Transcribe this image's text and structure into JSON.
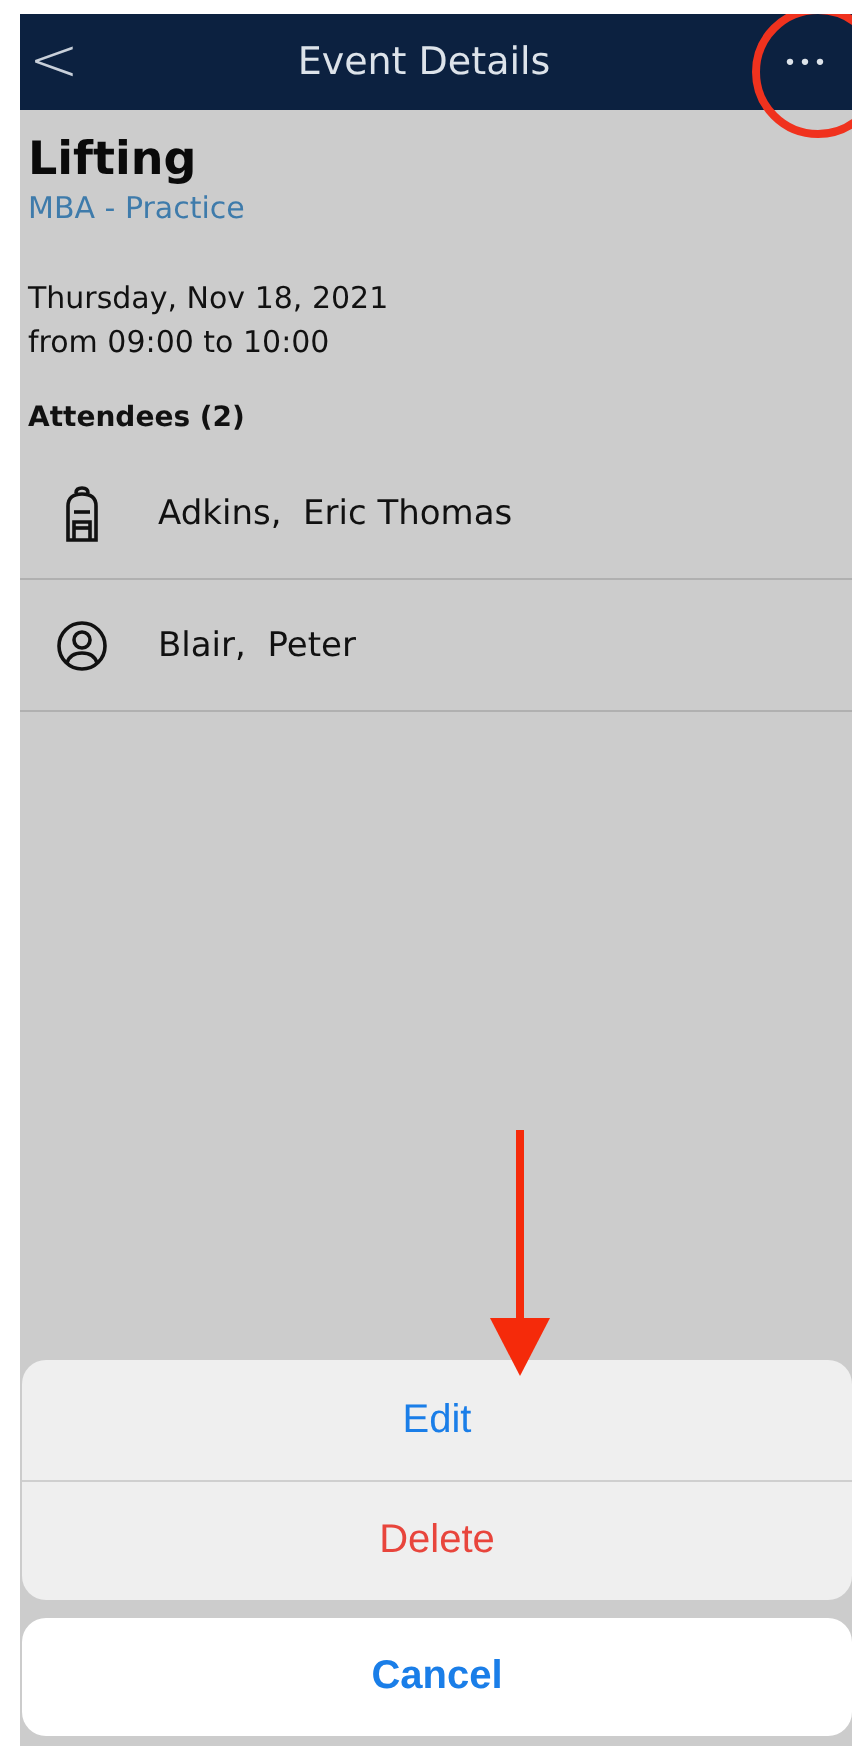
{
  "header": {
    "back": "<",
    "title": "Event Details",
    "more": "•••"
  },
  "event": {
    "title": "Lifting",
    "group": "MBA - Practice",
    "date": "Thursday, Nov 18, 2021",
    "time": "from 09:00 to 10:00"
  },
  "attendees": {
    "heading": "Attendees (2)",
    "items": [
      {
        "name": "Adkins,  Eric Thomas",
        "kind": "backpack"
      },
      {
        "name": "Blair,  Peter",
        "kind": "person"
      }
    ]
  },
  "action_sheet": {
    "actions": [
      {
        "label": "Edit",
        "kind": "default"
      },
      {
        "label": "Delete",
        "kind": "destructive"
      }
    ],
    "cancel": {
      "label": "Cancel"
    }
  }
}
